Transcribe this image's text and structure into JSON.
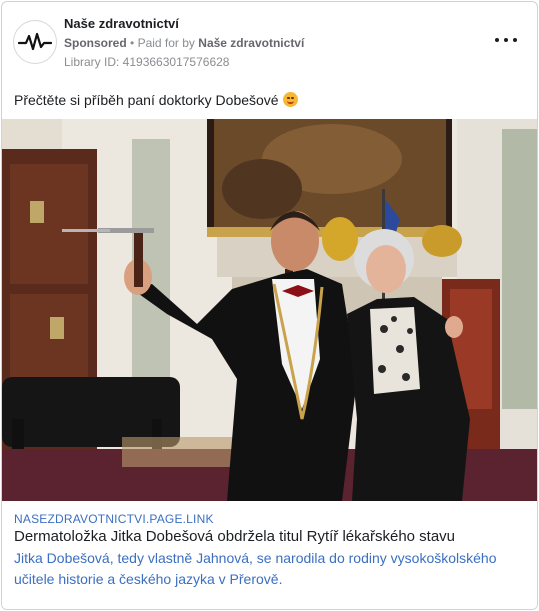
{
  "ad": {
    "page_name": "Naše zdravotnictví",
    "sponsored": "Sponsored",
    "paid_for_by_prefix": "Paid for by",
    "paid_for_by_name": "Naše zdravotnictví",
    "library_id": "Library ID: 4193663017576628",
    "more_icon": "more-horizontal-icon",
    "avatar_icon": "heartbeat-pulse-icon",
    "body_text": "Přečtěte si příběh paní doktorky Dobešové",
    "emoji": "smiling-face-emoji"
  },
  "link_preview": {
    "domain": "NASEZDRAVOTNICTVI.PAGE.LINK",
    "headline": "Dermatoložka Jitka Dobešová obdržela titul Rytíř lékařského stavu",
    "description": "Jitka Dobešová, tedy vlastně Jahnová, se narodila do rodiny vysokoškolského učitele historie a českého jazyka v Přerově."
  },
  "colors": {
    "link_blue": "#3b6fc2",
    "secondary_text": "#8a8d91"
  }
}
